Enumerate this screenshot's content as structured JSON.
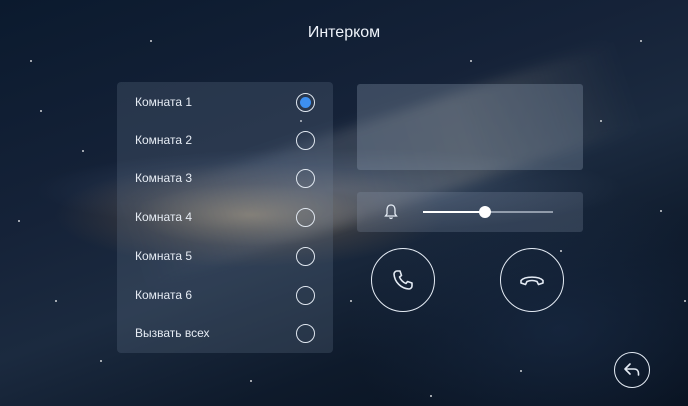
{
  "header": {
    "title": "Интерком"
  },
  "rooms": [
    {
      "label": "Комната 1",
      "selected": true
    },
    {
      "label": "Комната 2",
      "selected": false
    },
    {
      "label": "Комната 3",
      "selected": false
    },
    {
      "label": "Комната 4",
      "selected": false
    },
    {
      "label": "Комната 5",
      "selected": false
    },
    {
      "label": "Комната 6",
      "selected": false
    },
    {
      "label": "Вызвать всех",
      "selected": false
    }
  ],
  "volume": {
    "level": 0.48,
    "icon": "bell-icon"
  },
  "call_controls": {
    "answer_icon": "phone-answer-icon",
    "hangup_icon": "phone-hangup-icon",
    "back_icon": "back-arrow-icon"
  },
  "colors": {
    "accent": "#3d8ff0",
    "outline": "#e4ebf4"
  }
}
